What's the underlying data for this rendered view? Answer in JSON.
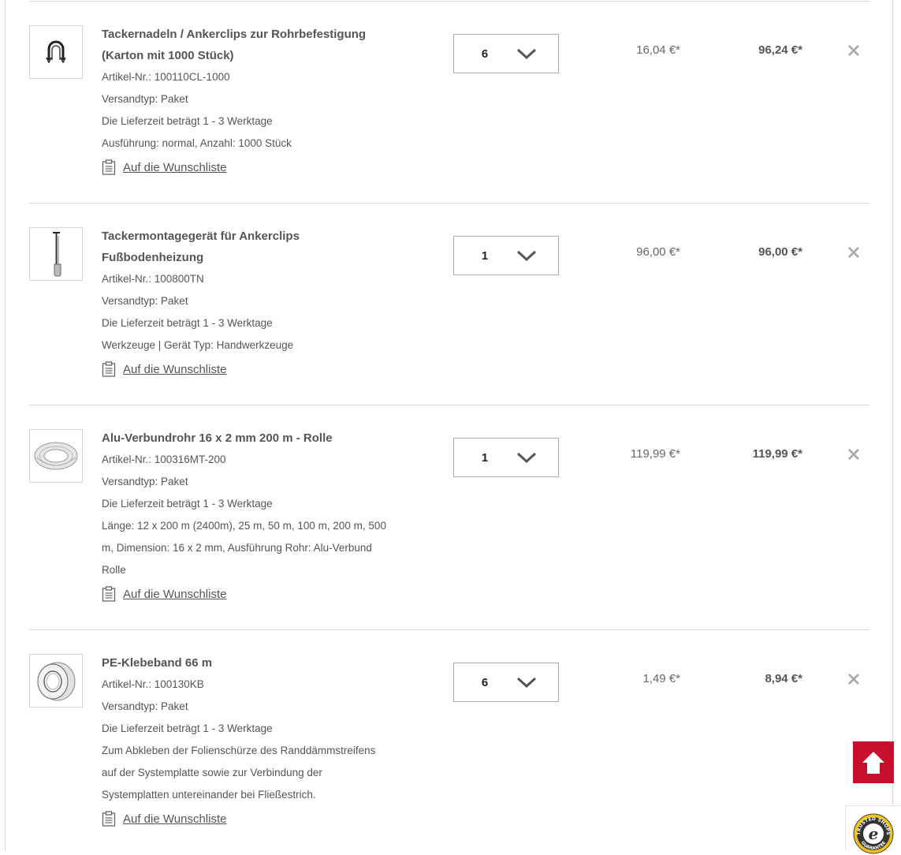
{
  "wishlist_label": "Auf die Wunschliste",
  "items": [
    {
      "title_lines": [
        "Tackernadeln / Ankerclips zur Rohrbefestigung",
        "(Karton mit 1000 Stück)"
      ],
      "meta": [
        "Artikel-Nr.: 100110CL-1000",
        "Versandtyp: Paket",
        "Die Lieferzeit beträgt 1 - 3 Werktage",
        "Ausführung: normal, Anzahl: 1000 Stück"
      ],
      "quantity": "6",
      "unit_price": "16,04 €*",
      "total_price": "96,24 €*",
      "image": "anchor-clip-image"
    },
    {
      "title_lines": [
        "Tackermontagegerät für Ankerclips",
        "Fußbodenheizung"
      ],
      "meta": [
        "Artikel-Nr.: 100800TN",
        "Versandtyp: Paket",
        "Die Lieferzeit beträgt 1 - 3 Werktage",
        "Werkzeuge | Gerät Typ: Handwerkzeuge"
      ],
      "quantity": "1",
      "unit_price": "96,00 €*",
      "total_price": "96,00 €*",
      "image": "tacker-tool-image"
    },
    {
      "title_lines": [
        "Alu-Verbundrohr 16 x 2 mm 200 m - Rolle"
      ],
      "meta": [
        "Artikel-Nr.: 100316MT-200",
        "Versandtyp: Paket",
        "Die Lieferzeit beträgt 1 - 3 Werktage",
        "Länge: 12 x 200 m (2400m), 25 m, 50 m, 100 m, 200 m, 500",
        "m, Dimension: 16 x 2 mm, Ausführung Rohr: Alu-Verbund",
        "Rolle"
      ],
      "quantity": "1",
      "unit_price": "119,99 €*",
      "total_price": "119,99 €*",
      "image": "pipe-roll-image"
    },
    {
      "title_lines": [
        "PE-Klebeband 66 m"
      ],
      "meta": [
        "Artikel-Nr.: 100130KB",
        "Versandtyp: Paket",
        "Die Lieferzeit beträgt 1 - 3 Werktage",
        "Zum Abkleben der Folienschürze des Randdämmstreifens",
        "auf der Systemplatte sowie zur Verbindung der",
        "Systemplatten untereinander bei Fließestrich."
      ],
      "quantity": "6",
      "unit_price": "1,49 €*",
      "total_price": "8,94 €*",
      "image": "tape-roll-image"
    }
  ],
  "trust_badge_text": "TRUSTED SHOPS GUARANTEE",
  "colors": {
    "accent": "#c8102e",
    "text": "#555555",
    "border": "#dcdcdc"
  }
}
